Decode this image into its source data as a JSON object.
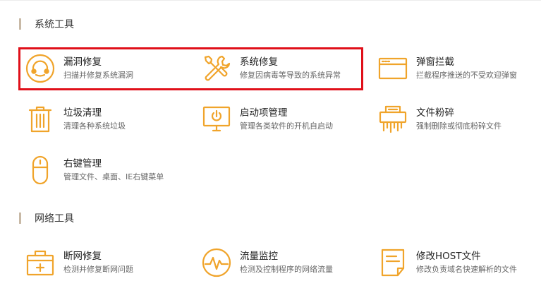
{
  "sections": [
    {
      "title": "系统工具"
    },
    {
      "title": "网络工具"
    }
  ],
  "tools": [
    {
      "name": "漏洞修复",
      "desc": "扫描并修复系统漏洞",
      "icon": "vulnerability-repair-icon"
    },
    {
      "name": "系统修复",
      "desc": "修复因病毒等导致的系统异常",
      "icon": "wrench-screwdriver-icon"
    },
    {
      "name": "弹窗拦截",
      "desc": "拦截程序推送的不受欢迎弹窗",
      "icon": "popup-window-icon"
    },
    {
      "name": "垃圾清理",
      "desc": "清理各种系统垃圾",
      "icon": "trash-can-icon"
    },
    {
      "name": "启动项管理",
      "desc": "管理各类软件的开机自启动",
      "icon": "monitor-power-icon"
    },
    {
      "name": "文件粉碎",
      "desc": "强制删除或彻底粉碎文件",
      "icon": "shredder-icon"
    },
    {
      "name": "右键管理",
      "desc": "管理文件、桌面、IE右键菜单",
      "icon": "mouse-icon"
    },
    {
      "name": "断网修复",
      "desc": "检测并修复断网问题",
      "icon": "network-kit-icon"
    },
    {
      "name": "流量监控",
      "desc": "检测及控制程序的网络流量",
      "icon": "traffic-gauge-icon"
    },
    {
      "name": "修改HOST文件",
      "desc": "修改负责域名快速解析的文件",
      "icon": "document-icon"
    }
  ],
  "colors": {
    "accent": "#f0a42b",
    "highlight": "#e0101a",
    "section_bar": "#c8b9a6"
  }
}
